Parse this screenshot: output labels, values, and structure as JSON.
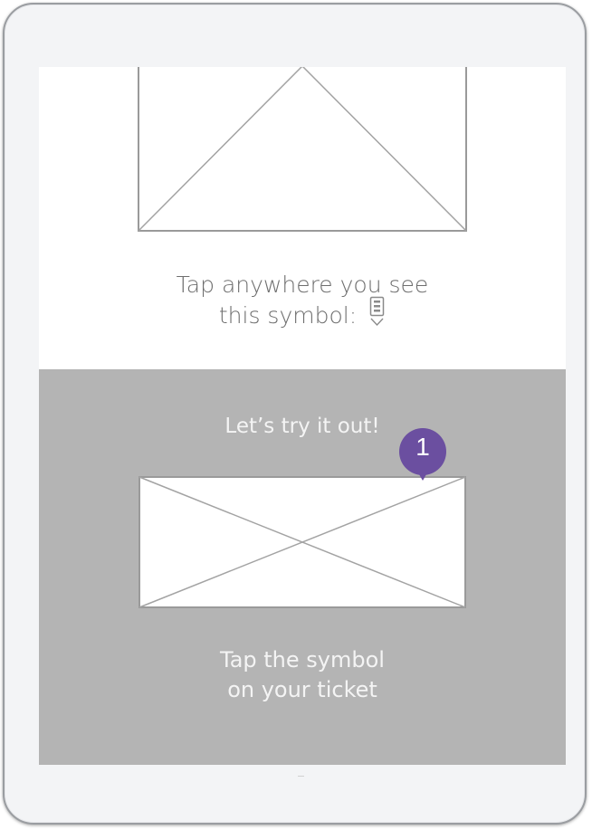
{
  "intro": {
    "instruction_line1": "Tap anywhere you see",
    "instruction_line2": "this symbol:",
    "symbol_icon": "ticket-marker-icon"
  },
  "tutorial": {
    "try_label": "Let’s try it out!",
    "step_badge": "1",
    "prompt_line1": "Tap the symbol",
    "prompt_line2": "on your ticket"
  },
  "colors": {
    "device_frame": "#f3f4f6",
    "screen_background": "#ffffff",
    "tutorial_background": "#b4b4b4",
    "badge": "#6b4fa0",
    "placeholder_line": "#999999"
  }
}
